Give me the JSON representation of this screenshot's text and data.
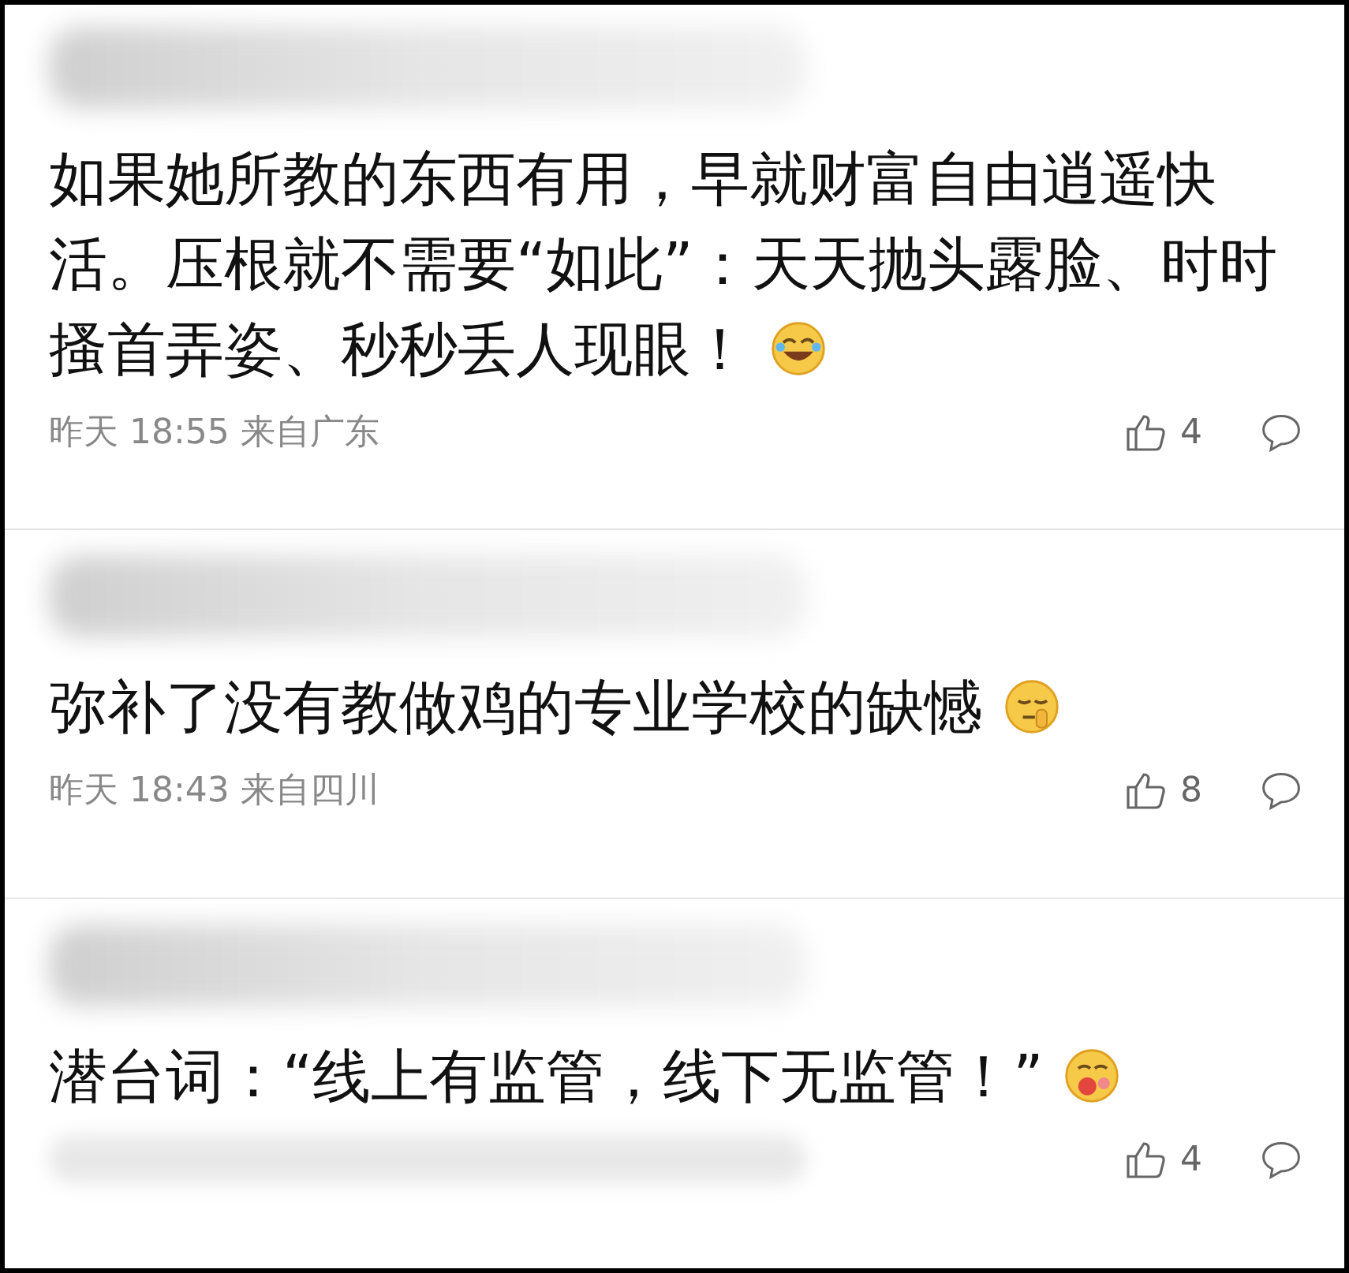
{
  "comments": [
    {
      "text": "如果她所教的东西有用，早就财富自由逍遥快活。压根就不需要“如此”：天天抛头露脸、时时搔首弄姿、秒秒丢人现眼！",
      "kind": "laugh",
      "meta": "昨天 18:55 来自广东",
      "likes": "4",
      "meta_hidden": false
    },
    {
      "text": "弥补了没有教做鸡的专业学校的缺憾",
      "kind": "shush",
      "meta": "昨天 18:43 来自四川",
      "likes": "8",
      "meta_hidden": false
    },
    {
      "text": "潜台词：“线上有监管，线下无监管！”",
      "kind": "drool",
      "likes": "4",
      "meta_hidden": true
    }
  ]
}
